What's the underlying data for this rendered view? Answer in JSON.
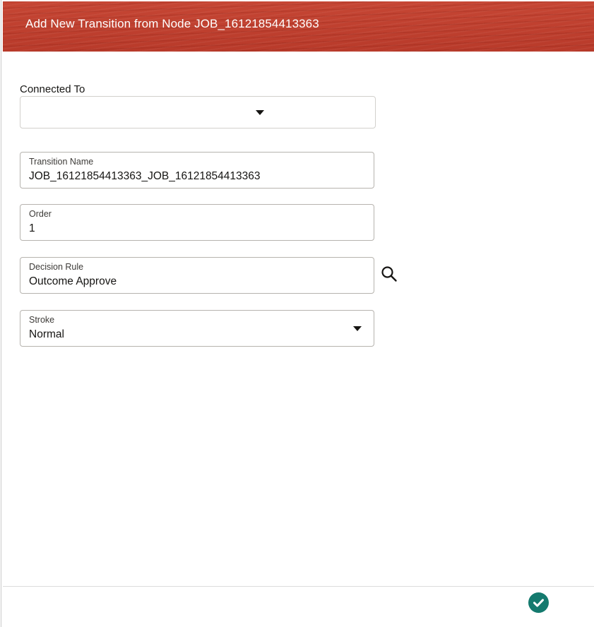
{
  "dialog": {
    "title": "Add New Transition from Node JOB_16121854413363"
  },
  "form": {
    "connected_to": {
      "label": "Connected To",
      "value": ""
    },
    "transition_name": {
      "label": "Transition Name",
      "value": "JOB_16121854413363_JOB_16121854413363"
    },
    "order": {
      "label": "Order",
      "value": "1"
    },
    "decision_rule": {
      "label": "Decision Rule",
      "value": "Outcome Approve",
      "action_icon": "search-icon"
    },
    "stroke": {
      "label": "Stroke",
      "value": "Normal"
    }
  },
  "footer": {
    "ok_icon": "checkmark-icon"
  },
  "colors": {
    "header_bg": "#c0392b",
    "ok_button": "#147a6e"
  }
}
